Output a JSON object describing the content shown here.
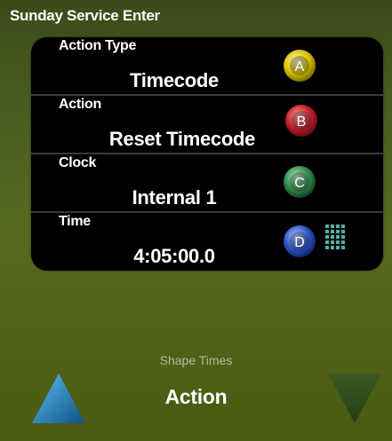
{
  "window": {
    "title": "Sunday Service Enter"
  },
  "rows": [
    {
      "label": "Action Type",
      "value": "Timecode",
      "button_letter": "A",
      "button_color": "#d8c400"
    },
    {
      "label": "Action",
      "value": "Reset Timecode",
      "button_letter": "B",
      "button_color": "#c41e2a"
    },
    {
      "label": "Clock",
      "value": "Internal 1",
      "button_letter": "C",
      "button_color": "#2f8a4a"
    },
    {
      "label": "Time",
      "value": "4:05:00.0",
      "button_letter": "D",
      "button_color": "#2f54c8"
    }
  ],
  "keypad_icon": "keypad-icon",
  "navigator": {
    "category_label": "Shape Times",
    "current_value": "Action",
    "up_color": "#1f7fc0",
    "down_color": "#2e4a1b"
  }
}
